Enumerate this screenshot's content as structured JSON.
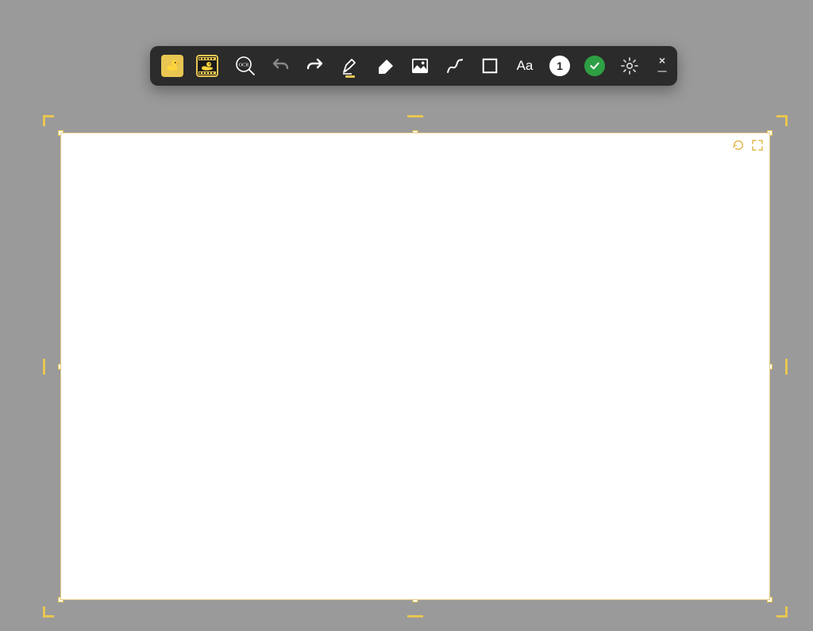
{
  "toolbar": {
    "ocr_label": "OCR",
    "text_tool_label": "Aa",
    "counter_badge": "1",
    "close_label": "×",
    "minimize_label": "—",
    "icons": {
      "duck_select": "duck-select",
      "duck_film": "duck-film",
      "ocr": "ocr-magnifier",
      "undo": "undo",
      "redo": "redo",
      "pen": "pen",
      "eraser": "eraser",
      "image": "image",
      "curve": "curve-line",
      "rectangle": "rectangle",
      "text": "text",
      "counter": "counter-badge",
      "confirm": "confirm-check",
      "settings": "settings-gear"
    }
  },
  "canvas": {
    "rotate_icon": "rotate",
    "fullscreen_icon": "fullscreen",
    "accent_color": "#e8c651"
  }
}
